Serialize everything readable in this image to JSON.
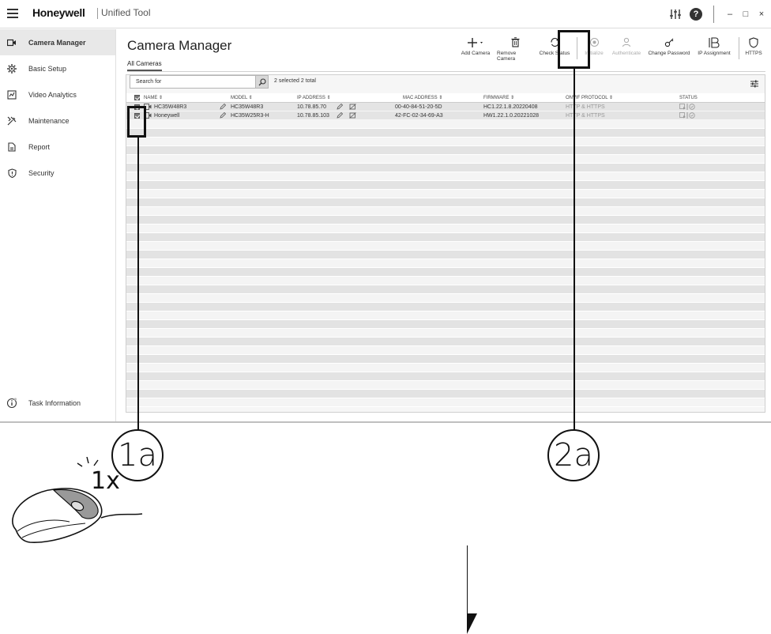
{
  "titlebar": {
    "brand": "Honeywell",
    "product": "Unified Tool",
    "icons": [
      "settings-sliders-icon",
      "help-icon"
    ],
    "window_controls": [
      "–",
      "□",
      "×"
    ]
  },
  "sidebar": {
    "items": [
      {
        "label": "Camera Manager",
        "icon": "camera-icon",
        "active": true
      },
      {
        "label": "Basic Setup",
        "icon": "gear-icon"
      },
      {
        "label": "Video Analytics",
        "icon": "analytics-icon"
      },
      {
        "label": "Maintenance",
        "icon": "tools-icon"
      },
      {
        "label": "Report",
        "icon": "document-icon"
      },
      {
        "label": "Security",
        "icon": "shield-icon"
      }
    ],
    "task_info": "Task Information"
  },
  "main": {
    "title": "Camera Manager",
    "tab": "All Cameras",
    "toolbar": {
      "add_camera": "Add Camera",
      "remove_camera": "Remove Camera",
      "check_status": "Check Status",
      "initialize": "Initialize",
      "authenticate": "Authenticate",
      "change_password": "Change Password",
      "ip_assignment": "IP Assignment",
      "https": "HTTPS"
    },
    "search_placeholder": "Search for",
    "selection_text": "2 selected 2 total",
    "columns": {
      "name": "NAME ⇕",
      "model": "MODEL ⇕",
      "ip": "IP ADDRESS ⇕",
      "mac": "MAC ADDRESS ⇕",
      "firmware": "FIRMWARE ⇕",
      "protocol": "ONVIF PROTOCOL ⇕",
      "status": "STATUS"
    },
    "rows": [
      {
        "name": "HC35W48R3",
        "model": "HC35W48R3",
        "ip": "10.78.85.70",
        "mac": "00-40-84-51-20-5D",
        "firmware": "HC1.22.1.8.20220408",
        "protocol": "HTTP & HTTPS"
      },
      {
        "name": "Honeywell",
        "model": "HC35W25R3-H",
        "ip": "10.78.85.103",
        "mac": "42-FC-02-34-69-A3",
        "firmware": "HW1.22.1.0.20221028",
        "protocol": "HTTP & HTTPS"
      }
    ]
  },
  "instructions": {
    "step_1": "1a",
    "step_2": "2a",
    "click_count": "1x"
  }
}
